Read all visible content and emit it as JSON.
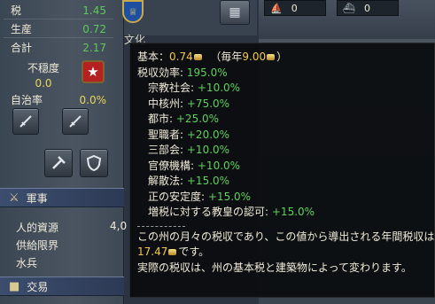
{
  "province": {
    "tax_label": "税",
    "tax_value": "1.45",
    "production_label": "生産",
    "production_value": "0.72",
    "total_label": "合計",
    "total_value": "2.17",
    "unrest_label": "不穏度",
    "unrest_value": "0.0",
    "autonomy_label": "自治率",
    "autonomy_value": "0.0%"
  },
  "military": {
    "header": "軍事",
    "manpower_label": "人的資源",
    "manpower_value": "4,0",
    "supply_label": "供給限界",
    "sailors_label": "水兵"
  },
  "trade": {
    "header": "交易"
  },
  "topbar": {
    "res1_value": "0",
    "res2_value": "0",
    "culture_label": "文化"
  },
  "tooltip": {
    "base_label": "基本：",
    "base_value": "0.74",
    "per_year_prefix": "（毎年",
    "per_year_value": "9.00",
    "per_year_suffix": "）",
    "efficiency_label": "税収効率:",
    "efficiency_value": "195.0%",
    "modifiers": [
      {
        "label": "宗教社会:",
        "value": "+10.0%"
      },
      {
        "label": "中核州:",
        "value": "+75.0%"
      },
      {
        "label": "都市:",
        "value": "+25.0%"
      },
      {
        "label": "聖職者:",
        "value": "+20.0%"
      },
      {
        "label": "三部会:",
        "value": "+10.0%"
      },
      {
        "label": "官僚機構:",
        "value": "+10.0%"
      },
      {
        "label": "解散法:",
        "value": "+15.0%"
      },
      {
        "label": "正の安定度:",
        "value": "+15.0%"
      },
      {
        "label": "増税に対する教皇の認可:",
        "value": "+15.0%"
      }
    ],
    "desc_line1": "この州の月々の税収であり、この値から導出される年間税収は",
    "annual_value": "17.47",
    "desc_line2_suffix": "です。",
    "desc_line3": "実際の税収は、州の基本税と建築物によって変わります。"
  },
  "colors": {
    "positive": "#5fd15b",
    "gold": "#f2c750",
    "tooltip_bg": "#0a0c0e"
  },
  "icons": [
    "crossed-swords-icon",
    "shield-icon",
    "rebel-icon",
    "coin-icon",
    "ship-icon",
    "fleet-icon"
  ]
}
